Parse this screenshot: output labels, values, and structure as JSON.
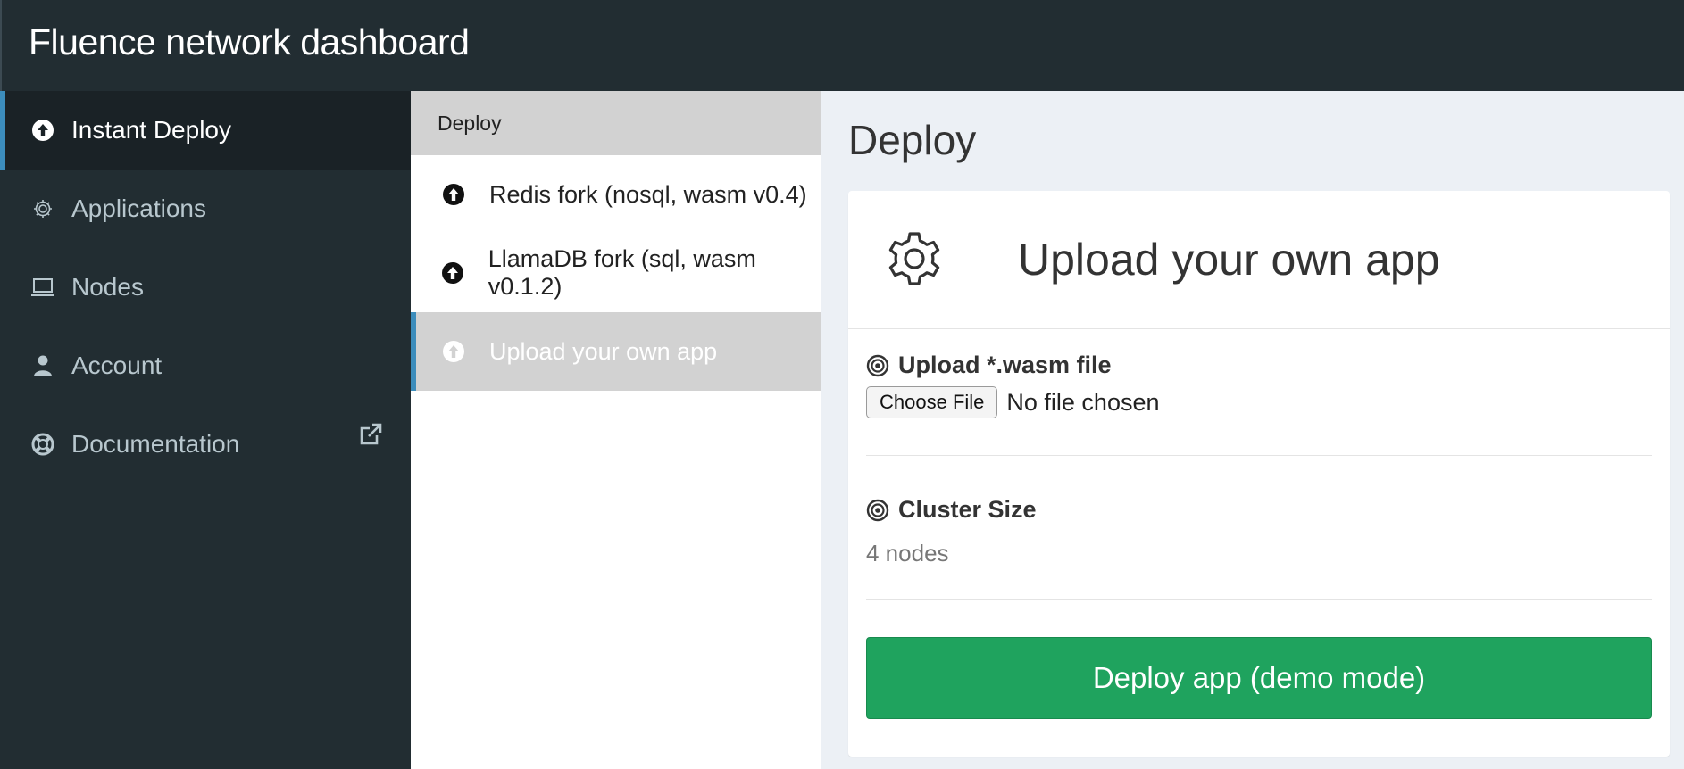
{
  "app": {
    "title": "Fluence network dashboard"
  },
  "sidebar": {
    "items": [
      {
        "label": "Instant Deploy",
        "icon": "upload-circle-icon",
        "active": true
      },
      {
        "label": "Applications",
        "icon": "gear-icon",
        "active": false
      },
      {
        "label": "Nodes",
        "icon": "laptop-icon",
        "active": false
      },
      {
        "label": "Account",
        "icon": "user-icon",
        "active": false
      },
      {
        "label": "Documentation",
        "icon": "lifebuoy-icon",
        "external_icon": "external-link-icon",
        "active": false
      }
    ]
  },
  "middle": {
    "header": "Deploy",
    "items": [
      {
        "label": "Redis fork (nosql, wasm v0.4)",
        "icon": "upload-circle-icon",
        "active": false
      },
      {
        "label": "LlamaDB fork (sql, wasm v0.1.2)",
        "icon": "upload-circle-icon",
        "active": false
      },
      {
        "label": "Upload your own app",
        "icon": "upload-circle-icon",
        "active": true
      }
    ]
  },
  "main": {
    "page_title": "Deploy",
    "card": {
      "title": "Upload your own app",
      "header_icon": "gear-icon",
      "upload": {
        "label": "Upload *.wasm file",
        "icon": "bullseye-icon",
        "choose_button": "Choose File",
        "file_status": "No file chosen"
      },
      "cluster": {
        "label": "Cluster Size",
        "icon": "bullseye-icon",
        "value": "4 nodes"
      },
      "deploy_button": "Deploy app (demo mode)"
    }
  },
  "colors": {
    "sidebar_bg": "#222d32",
    "active_accent": "#3c8dbc",
    "deploy_green": "#1fa35e",
    "content_bg": "#ecf0f5"
  }
}
